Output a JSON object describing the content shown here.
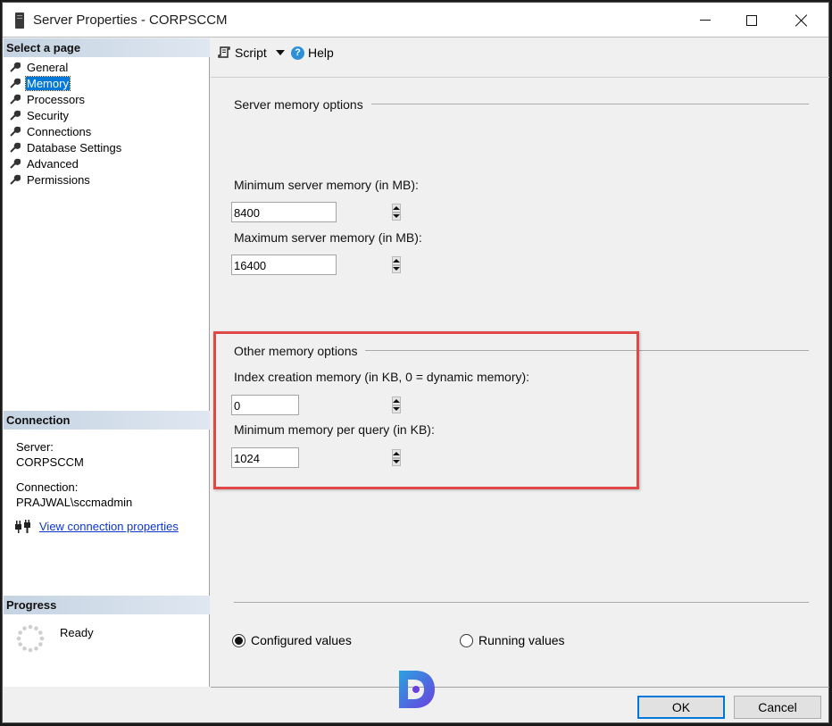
{
  "window": {
    "title": "Server Properties - CORPSCCM"
  },
  "sidebar": {
    "select_page_header": "Select a page",
    "items": [
      {
        "label": "General",
        "selected": false
      },
      {
        "label": "Memory",
        "selected": true
      },
      {
        "label": "Processors",
        "selected": false
      },
      {
        "label": "Security",
        "selected": false
      },
      {
        "label": "Connections",
        "selected": false
      },
      {
        "label": "Database Settings",
        "selected": false
      },
      {
        "label": "Advanced",
        "selected": false
      },
      {
        "label": "Permissions",
        "selected": false
      }
    ],
    "connection": {
      "header": "Connection",
      "server_label": "Server:",
      "server_value": "CORPSCCM",
      "connection_label": "Connection:",
      "connection_value": "PRAJWAL\\sccmadmin",
      "link_label": "View connection properties"
    },
    "progress": {
      "header": "Progress",
      "status": "Ready"
    }
  },
  "toolbar": {
    "script_label": "Script",
    "help_label": "Help",
    "help_glyph": "?"
  },
  "main": {
    "server_memory": {
      "title": "Server memory options",
      "min_label": "Minimum server memory (in MB):",
      "min_value": "8400",
      "max_label": "Maximum server memory (in MB):",
      "max_value": "16400"
    },
    "other_memory": {
      "title": "Other memory options",
      "index_label": "Index creation memory (in KB, 0 = dynamic memory):",
      "index_value": "0",
      "min_query_label": "Minimum memory per query (in KB):",
      "min_query_value": "1024"
    },
    "view_mode": {
      "configured_label": "Configured values",
      "running_label": "Running values",
      "selected": "configured"
    }
  },
  "footer": {
    "ok_label": "OK",
    "cancel_label": "Cancel"
  },
  "colors": {
    "selection": "#0078d7",
    "highlight_box": "#e04848",
    "link": "#0b36c9"
  }
}
